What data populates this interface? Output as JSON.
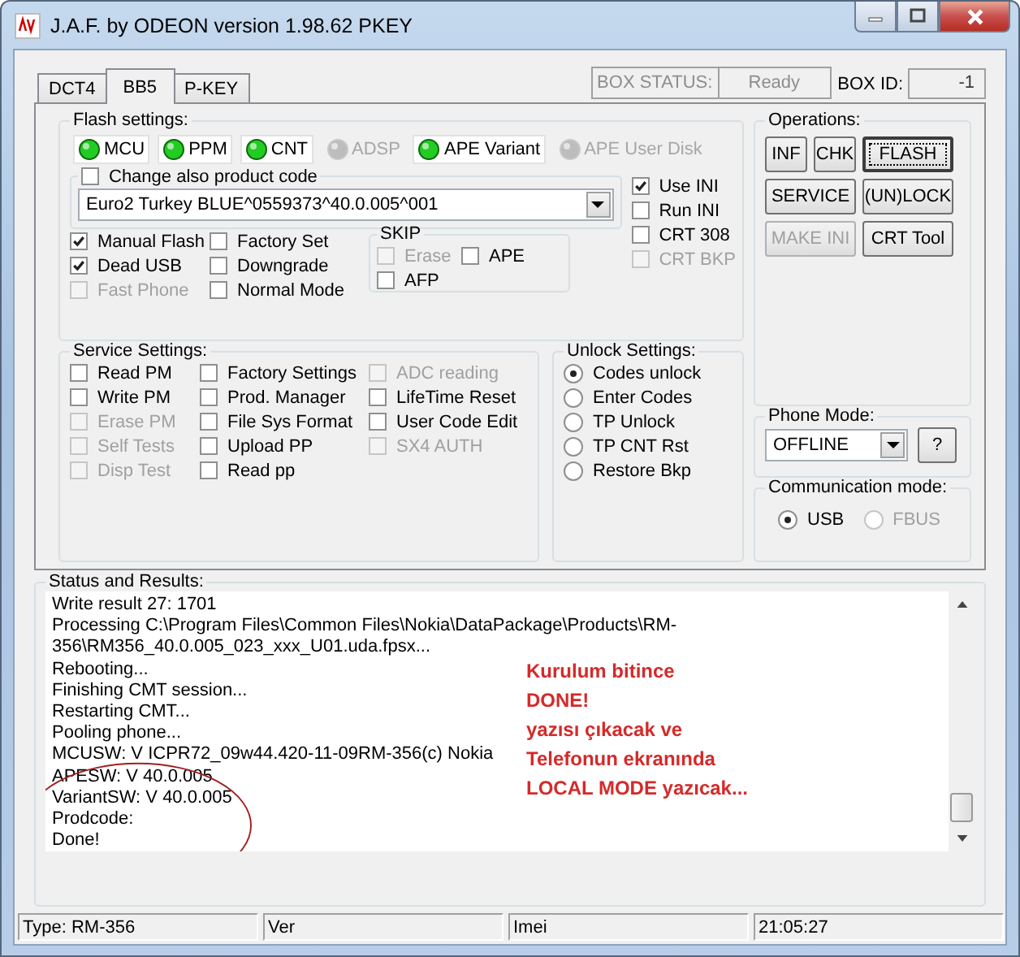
{
  "window": {
    "title": "J.A.F. by ODEON version 1.98.62 PKEY"
  },
  "tabs": [
    {
      "label": "DCT4",
      "selected": false
    },
    {
      "label": "BB5",
      "selected": true
    },
    {
      "label": "P-KEY",
      "selected": false
    }
  ],
  "box_status": {
    "label": "BOX STATUS:",
    "value": "Ready"
  },
  "box_id": {
    "label": "BOX ID:",
    "value": "-1"
  },
  "flash_settings": {
    "title": "Flash settings:",
    "indicators": [
      {
        "label": "MCU",
        "on": true
      },
      {
        "label": "PPM",
        "on": true
      },
      {
        "label": "CNT",
        "on": true
      },
      {
        "label": "ADSP",
        "on": false
      },
      {
        "label": "APE Variant",
        "on": true
      },
      {
        "label": "APE User Disk",
        "on": false
      }
    ],
    "product_code": {
      "label": "Change also product code",
      "checked": false,
      "disabled": false
    },
    "product_select": "Euro2 Turkey BLUE^0559373^40.0.005^001",
    "ini_options": [
      {
        "label": "Use INI",
        "checked": true,
        "disabled": false
      },
      {
        "label": "Run INI",
        "checked": false,
        "disabled": false
      },
      {
        "label": "CRT 308",
        "checked": false,
        "disabled": false
      },
      {
        "label": "CRT BKP",
        "checked": false,
        "disabled": true
      }
    ],
    "options_1": [
      {
        "label": "Manual Flash",
        "checked": true,
        "disabled": false
      },
      {
        "label": "Dead USB",
        "checked": true,
        "disabled": false
      },
      {
        "label": "Fast Phone",
        "checked": false,
        "disabled": true
      }
    ],
    "options_2": [
      {
        "label": "Factory Set",
        "checked": false,
        "disabled": false
      },
      {
        "label": "Downgrade",
        "checked": false,
        "disabled": false
      },
      {
        "label": "Normal Mode",
        "checked": false,
        "disabled": false
      }
    ],
    "skip": {
      "title": "SKIP",
      "options": [
        {
          "label": "Erase",
          "checked": false,
          "disabled": true
        },
        {
          "label": "APE",
          "checked": false,
          "disabled": false
        },
        {
          "label": "AFP",
          "checked": false,
          "disabled": false
        }
      ]
    }
  },
  "service_settings": {
    "title": "Service Settings:",
    "columns": [
      [
        {
          "label": "Read PM",
          "checked": false,
          "disabled": false
        },
        {
          "label": "Write PM",
          "checked": false,
          "disabled": false
        },
        {
          "label": "Erase PM",
          "checked": false,
          "disabled": true
        },
        {
          "label": "Self Tests",
          "checked": false,
          "disabled": true
        },
        {
          "label": "Disp Test",
          "checked": false,
          "disabled": true
        }
      ],
      [
        {
          "label": "Factory Settings",
          "checked": false,
          "disabled": false
        },
        {
          "label": "Prod. Manager",
          "checked": false,
          "disabled": false
        },
        {
          "label": "File Sys Format",
          "checked": false,
          "disabled": false
        },
        {
          "label": "Upload PP",
          "checked": false,
          "disabled": false
        },
        {
          "label": "Read pp",
          "checked": false,
          "disabled": false
        }
      ],
      [
        {
          "label": "ADC reading",
          "checked": false,
          "disabled": true
        },
        {
          "label": "LifeTime Reset",
          "checked": false,
          "disabled": false
        },
        {
          "label": "User Code Edit",
          "checked": false,
          "disabled": false
        },
        {
          "label": "SX4 AUTH",
          "checked": false,
          "disabled": true
        }
      ]
    ]
  },
  "unlock_settings": {
    "title": "Unlock Settings:",
    "options": [
      {
        "label": "Codes unlock",
        "selected": true
      },
      {
        "label": "Enter Codes",
        "selected": false
      },
      {
        "label": "TP Unlock",
        "selected": false
      },
      {
        "label": "TP CNT Rst",
        "selected": false
      },
      {
        "label": "Restore Bkp",
        "selected": false
      }
    ]
  },
  "operations": {
    "title": "Operations:",
    "buttons": [
      {
        "label": "INF",
        "disabled": false,
        "focused": false
      },
      {
        "label": "CHK",
        "disabled": false,
        "focused": false
      },
      {
        "label": "FLASH",
        "disabled": false,
        "focused": true
      },
      {
        "label": "SERVICE",
        "disabled": false,
        "focused": false
      },
      {
        "label": "(UN)LOCK",
        "disabled": false,
        "focused": false
      },
      {
        "label": "MAKE INI",
        "disabled": true,
        "focused": false
      },
      {
        "label": "CRT Tool",
        "disabled": false,
        "focused": false
      }
    ]
  },
  "phone_mode": {
    "title": "Phone Mode:",
    "value": "OFFLINE",
    "help": "?"
  },
  "communication_mode": {
    "title": "Communication mode:",
    "options": [
      {
        "label": "USB",
        "selected": true,
        "disabled": false
      },
      {
        "label": "FBUS",
        "selected": false,
        "disabled": true
      }
    ]
  },
  "status": {
    "title": "Status and Results:",
    "lines": [
      "Write result 27: 1701",
      "Processing C:\\Program Files\\Common Files\\Nokia\\DataPackage\\Products\\RM-",
      "356\\RM356_40.0.005_023_xxx_U01.uda.fpsx...",
      "Rebooting...",
      "Finishing CMT session...",
      "Restarting CMT...",
      "Pooling phone...",
      "MCUSW: V ICPR72_09w44.420-11-09RM-356(c) Nokia",
      "APESW: V 40.0.005",
      "VariantSW: V 40.0.005",
      "Prodcode:",
      "Done!"
    ],
    "annotation": [
      "Kurulum bitince",
      "DONE!",
      "yazısı çıkacak ve",
      "Telefonun ekranında",
      "LOCAL MODE yazıcak..."
    ]
  },
  "status_bar": [
    "Type: RM-356",
    "Ver",
    "Imei",
    "21:05:27"
  ]
}
